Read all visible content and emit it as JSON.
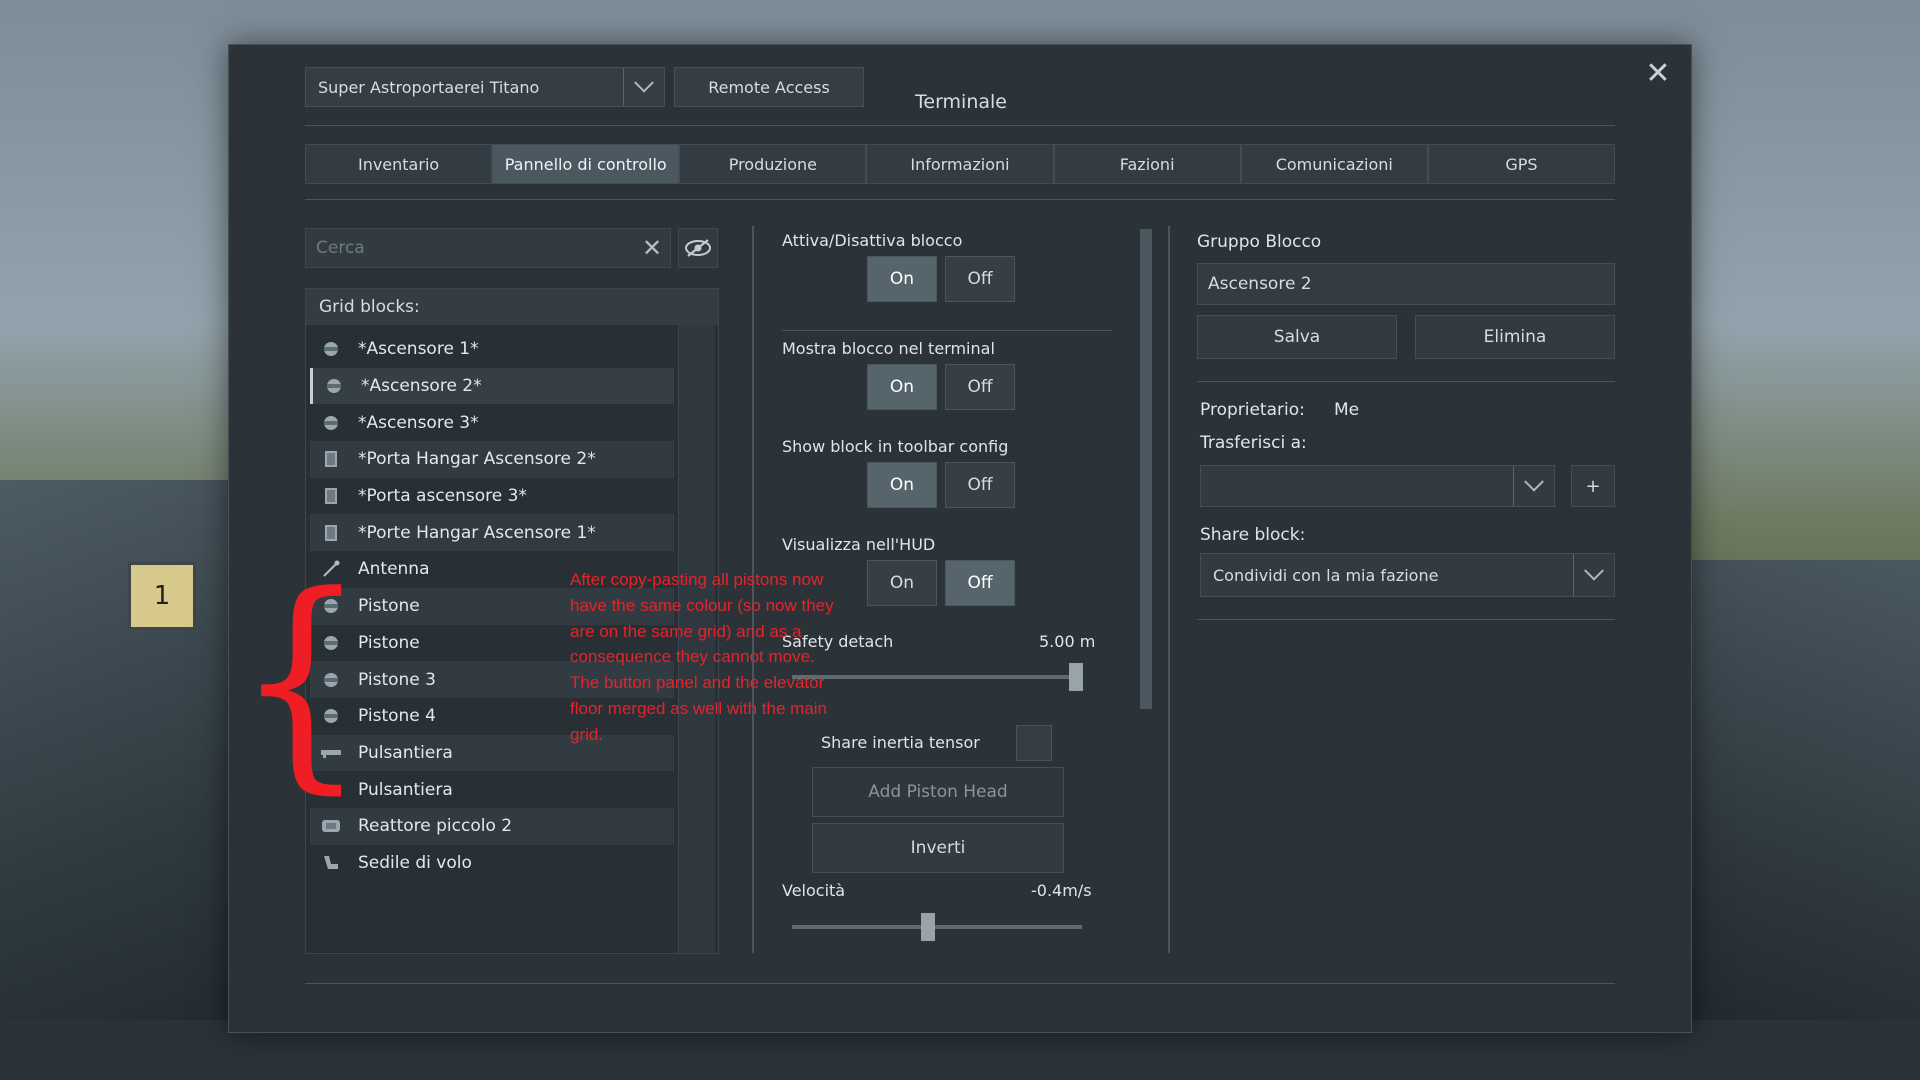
{
  "window": {
    "title": "Terminale",
    "grid_selector": "Super Astroportaerei Titano",
    "remote_access": "Remote Access"
  },
  "tabs": [
    "Inventario",
    "Pannello di controllo",
    "Produzione",
    "Informazioni",
    "Fazioni",
    "Comunicazioni",
    "GPS"
  ],
  "active_tab": "Pannello di controllo",
  "search": {
    "placeholder": "Cerca",
    "value": ""
  },
  "grid_blocks": {
    "header": "Grid blocks:",
    "items": [
      {
        "label": "*Ascensore 1*",
        "icon": "piston-icon"
      },
      {
        "label": "*Ascensore 2*",
        "icon": "piston-icon",
        "selected": true
      },
      {
        "label": "*Ascensore 3*",
        "icon": "piston-icon"
      },
      {
        "label": "*Porta Hangar Ascensore 2*",
        "icon": "door-icon"
      },
      {
        "label": "*Porta ascensore 3*",
        "icon": "door-icon"
      },
      {
        "label": "*Porte Hangar Ascensore 1*",
        "icon": "door-icon"
      },
      {
        "label": "Antenna",
        "icon": "antenna-icon"
      },
      {
        "label": "Pistone",
        "icon": "piston-icon"
      },
      {
        "label": "Pistone",
        "icon": "piston-icon"
      },
      {
        "label": "Pistone 3",
        "icon": "piston-icon"
      },
      {
        "label": "Pistone 4",
        "icon": "piston-icon"
      },
      {
        "label": "Pulsantiera",
        "icon": "button-panel-icon"
      },
      {
        "label": "Pulsantiera",
        "icon": "button-panel-icon"
      },
      {
        "label": "Reattore piccolo 2",
        "icon": "reactor-icon"
      },
      {
        "label": "Sedile di volo",
        "icon": "seat-icon"
      }
    ]
  },
  "controls": {
    "toggle_block": {
      "label": "Attiva/Disattiva blocco",
      "on": "On",
      "off": "Off",
      "value": "On"
    },
    "show_in_terminal": {
      "label": "Mostra blocco nel terminal",
      "on": "On",
      "off": "Off",
      "value": "On"
    },
    "show_in_toolbar": {
      "label": "Show block in toolbar config",
      "on": "On",
      "off": "Off",
      "value": "On"
    },
    "show_on_hud": {
      "label": "Visualizza nell'HUD",
      "on": "On",
      "off": "Off",
      "value": "Off"
    },
    "safety_detach": {
      "label": "Safety detach",
      "value_text": "5.00 m",
      "fraction": 0.98
    },
    "share_inertia": {
      "label": "Share inertia tensor",
      "checked": false
    },
    "add_piston_head": "Add Piston Head",
    "reverse": "Inverti",
    "velocity": {
      "label": "Velocità",
      "value_text": "-0.4m/s",
      "fraction": 0.47
    }
  },
  "group": {
    "title": "Gruppo Blocco",
    "name": "Ascensore 2",
    "save": "Salva",
    "delete": "Elimina"
  },
  "ownership": {
    "owner_label": "Proprietario:",
    "owner_value": "Me",
    "transfer_label": "Trasferisci a:",
    "transfer_value": "",
    "plus": "+",
    "share_label": "Share block:",
    "share_value": "Condividi con la mia fazione"
  },
  "annotation": {
    "text": "After copy-pasting all pistons now have the same colour (so now they are on the same grid) and as a consequence they cannot move. The button panel and the elevator floor merged as well with the main grid.",
    "brace": "{",
    "color": "#e6232a"
  },
  "background": {
    "counter_label": "1"
  }
}
